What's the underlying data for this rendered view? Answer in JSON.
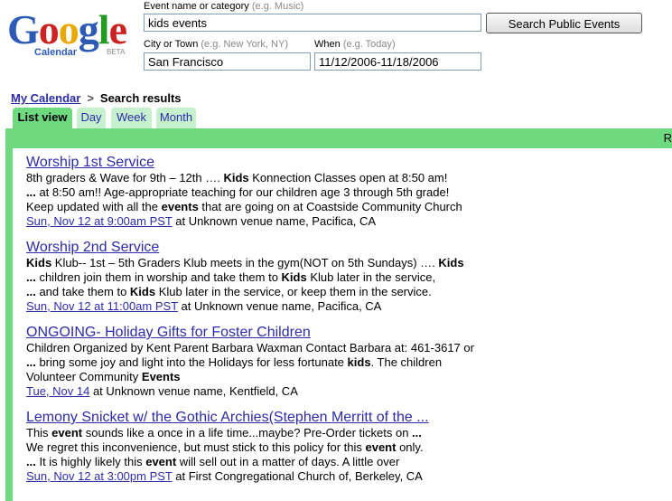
{
  "logo": {
    "letters": [
      "G",
      "o",
      "o",
      "g",
      "l",
      "e"
    ],
    "letter_colors": [
      "#2c5ab4",
      "#cc2222",
      "#e8a800",
      "#2c5ab4",
      "#229922",
      "#cc2222"
    ],
    "sub": "Calendar",
    "beta": "BETA"
  },
  "search": {
    "event_label": "Event name or category",
    "event_hint": "(e.g. Music)",
    "event_value": "kids events",
    "city_label": "City or Town",
    "city_hint": "(e.g. New York, NY)",
    "city_value": "San Francisco",
    "when_label": "When",
    "when_hint": "(e.g. Today)",
    "when_value": "11/12/2006-11/18/2006",
    "button": "Search Public Events"
  },
  "breadcrumb": {
    "link": "My Calendar",
    "sep": ">",
    "current": "Search results"
  },
  "tabs": [
    {
      "label": "List view",
      "active": true
    },
    {
      "label": "Day",
      "active": false
    },
    {
      "label": "Week",
      "active": false
    },
    {
      "label": "Month",
      "active": false
    }
  ],
  "panel": {
    "right_text": "R"
  },
  "events": [
    {
      "title": "Worship 1st Service",
      "lines": [
        [
          [
            "8th graders & Wave for 9th – 12th …. ",
            false
          ],
          [
            "Kids",
            true
          ],
          [
            " Konnection Classes open at 8:50 am!",
            false
          ]
        ],
        [
          [
            "...",
            true
          ],
          [
            " at 8:50 am!! Age-appropriate teaching for our children age 3 through 5th grade!",
            false
          ]
        ],
        [
          [
            "Keep updated with all the ",
            false
          ],
          [
            "events",
            true
          ],
          [
            " that are going on at Coastside Community Church",
            false
          ]
        ]
      ],
      "date": "Sun, Nov 12 at 9:00am PST",
      "venue": " at Unknown venue name, Pacifica, CA"
    },
    {
      "title": "Worship 2nd Service",
      "lines": [
        [
          [
            "Kids",
            true
          ],
          [
            " Klub-- 1st – 5th Graders Klub meets in the gym(NOT on 5th Sundays) …. ",
            false
          ],
          [
            "Kids",
            true
          ]
        ],
        [
          [
            "...",
            true
          ],
          [
            " children join them in worship and take them to ",
            false
          ],
          [
            "Kids",
            true
          ],
          [
            " Klub later in the service,",
            false
          ]
        ],
        [
          [
            "...",
            true
          ],
          [
            " and take them to ",
            false
          ],
          [
            "Kids",
            true
          ],
          [
            " Klub later in the service, or keep them in the service.",
            false
          ]
        ]
      ],
      "date": "Sun, Nov 12 at 11:00am PST",
      "venue": " at Unknown venue name, Pacifica, CA"
    },
    {
      "title": "ONGOING- Holiday Gifts for Foster Children",
      "lines": [
        [
          [
            "Children Organized by Kent Parent Barbara Waxman Contact Barbara at: 461-3617 or",
            false
          ]
        ],
        [
          [
            "...",
            true
          ],
          [
            " bring some joy and light into the Holidays for less fortunate ",
            false
          ],
          [
            "kids",
            true
          ],
          [
            ". The children",
            false
          ]
        ],
        [
          [
            "Volunteer Community ",
            false
          ],
          [
            "Events",
            true
          ]
        ]
      ],
      "date": "Tue, Nov 14",
      "venue": " at Unknown venue name, Kentfield, CA"
    },
    {
      "title": "Lemony Snicket w/ the Gothic Archies(Stephen Merritt of the ...",
      "lines": [
        [
          [
            "This ",
            false
          ],
          [
            "event",
            true
          ],
          [
            " sounds like a once in a life time...maybe? Pre-Order tickets on ",
            false
          ],
          [
            "...",
            true
          ]
        ],
        [
          [
            "We regret this inconvenience, but must stick to this policy for this ",
            false
          ],
          [
            "event",
            true
          ],
          [
            " only.",
            false
          ]
        ],
        [
          [
            "...",
            true
          ],
          [
            " It is highly likely this ",
            false
          ],
          [
            "event",
            true
          ],
          [
            " will sell out in a matter of days. A little over",
            false
          ]
        ]
      ],
      "date": "Sun, Nov 12 at 3:00pm PST",
      "venue": " at First Congregational Church of, Berkeley, CA"
    }
  ]
}
